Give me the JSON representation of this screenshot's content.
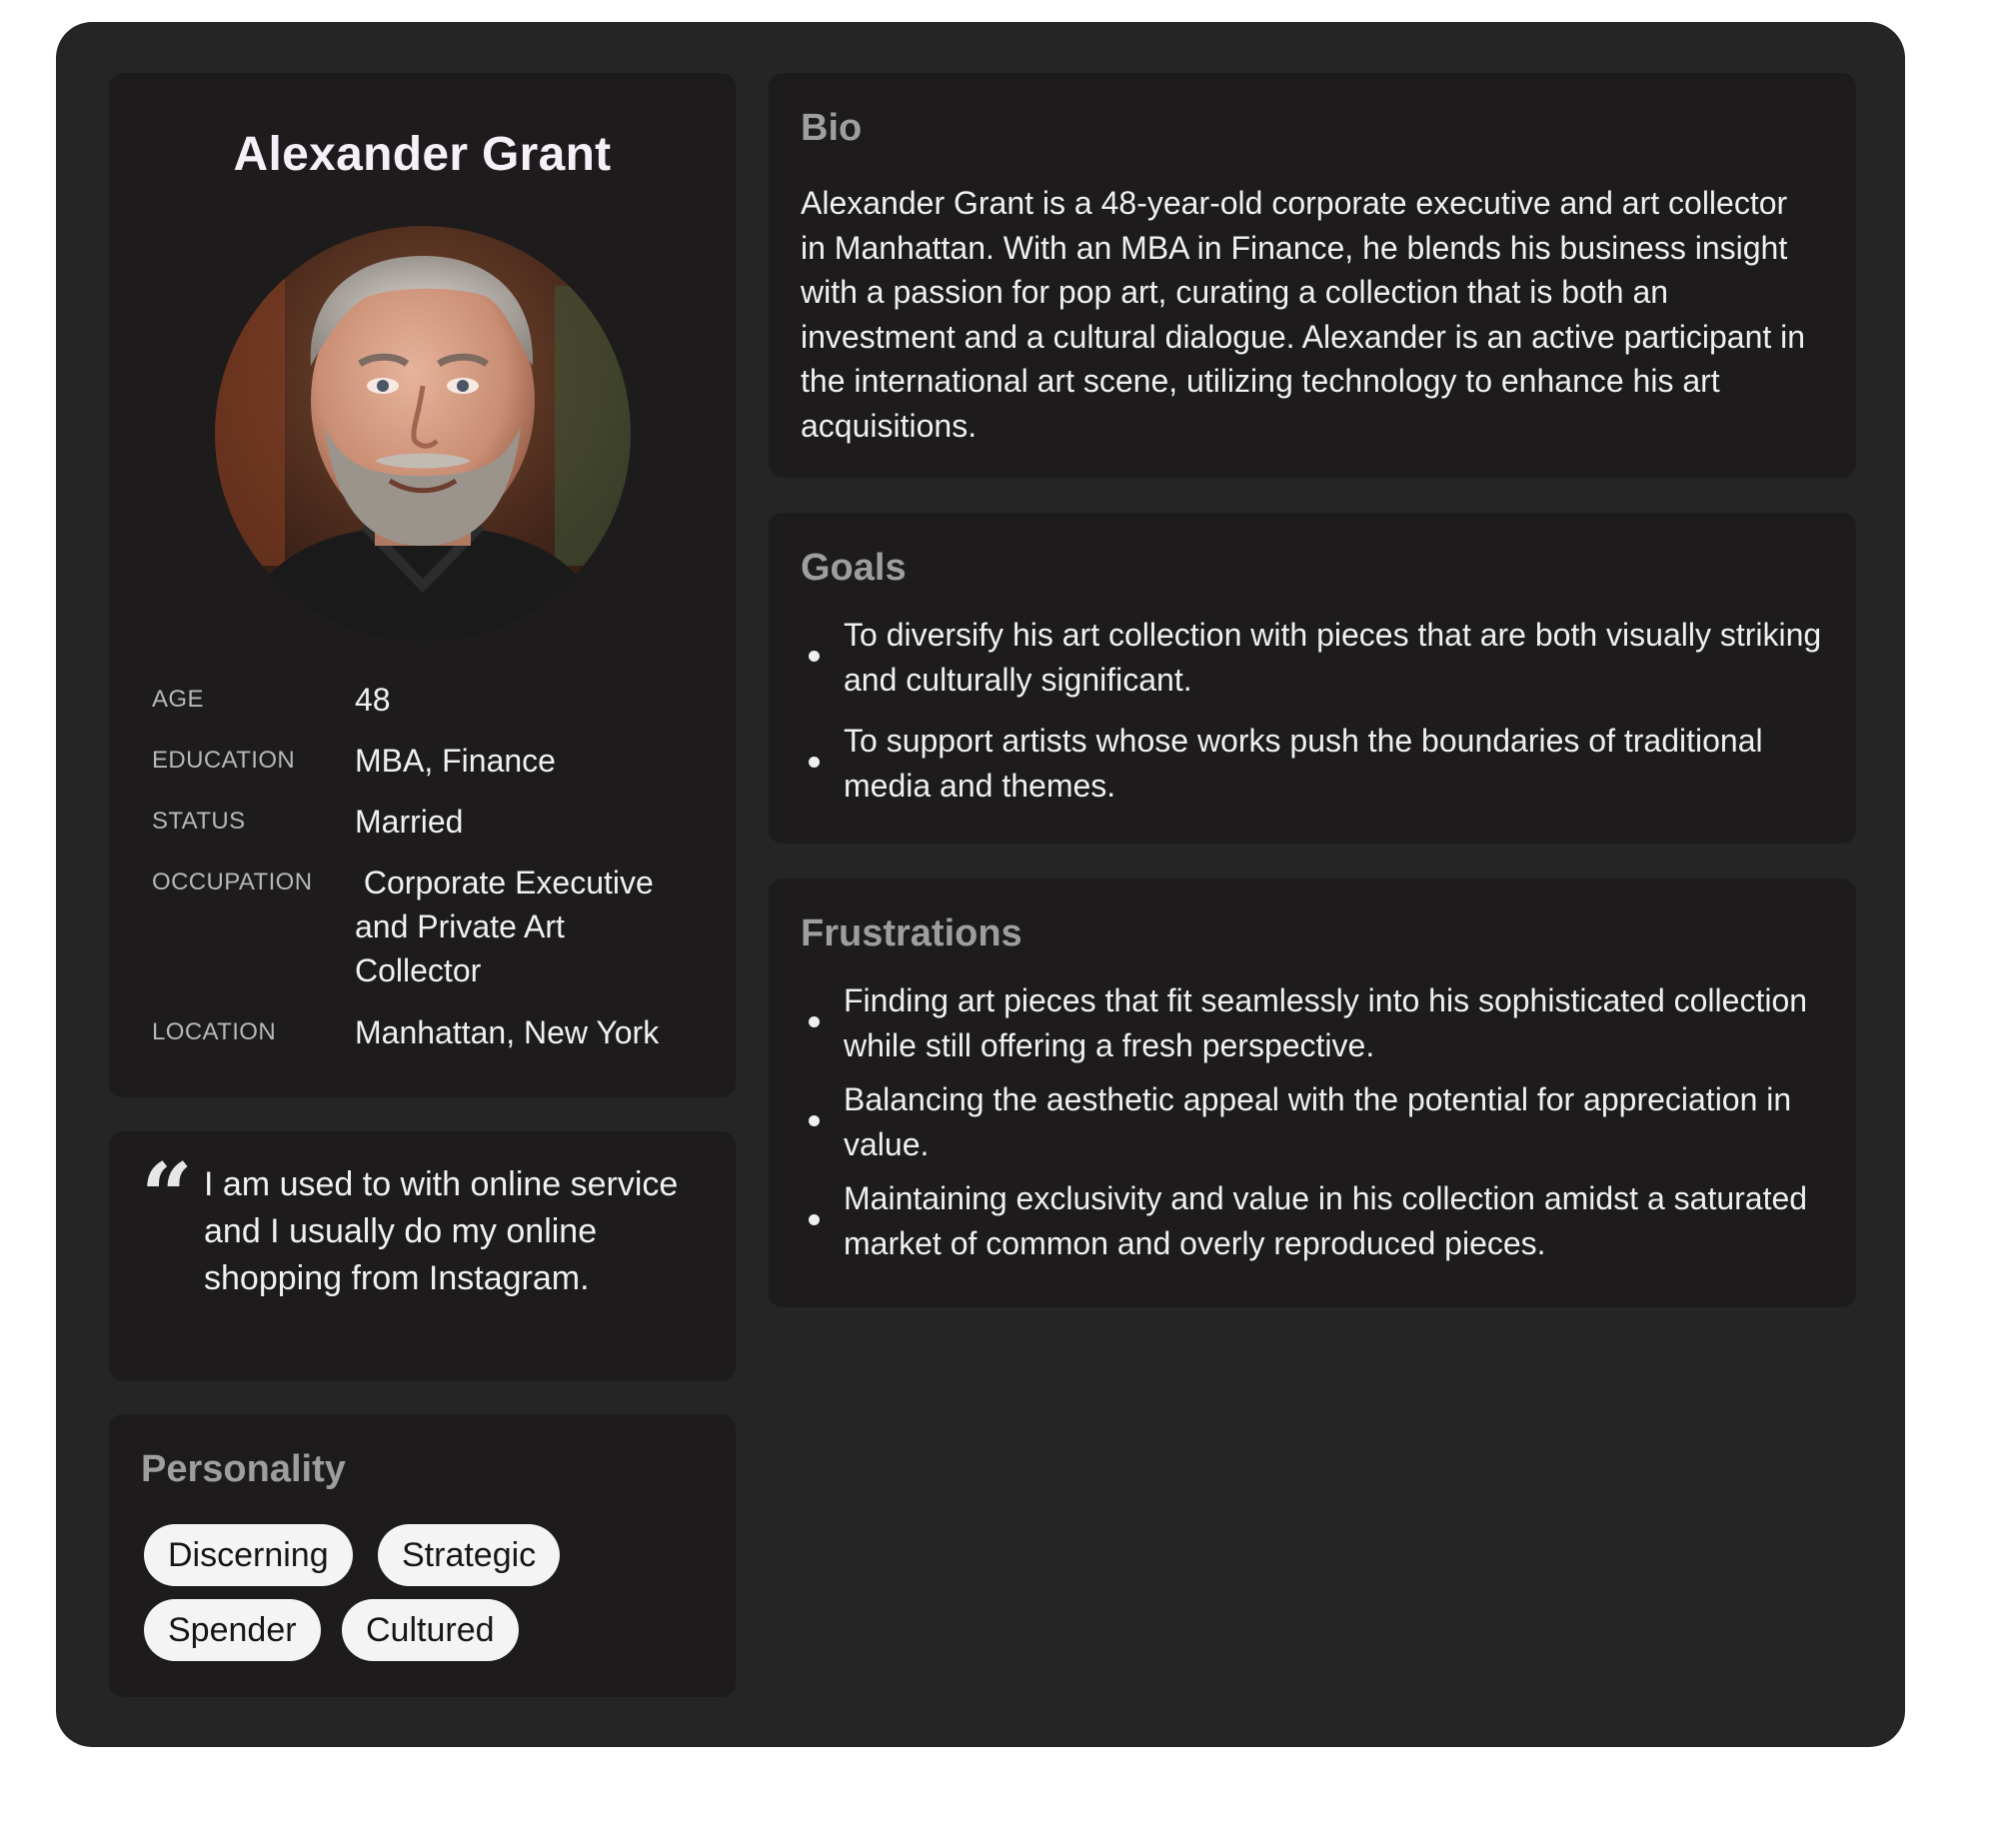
{
  "persona": {
    "name": "Alexander Grant",
    "facts": [
      {
        "label": "AGE",
        "value": "48"
      },
      {
        "label": "EDUCATION",
        "value": "MBA, Finance"
      },
      {
        "label": "STATUS",
        "value": "Married"
      },
      {
        "label": "OCCUPATION",
        "value": " Corporate Executive and Private Art Collector"
      },
      {
        "label": "LOCATION",
        "value": "Manhattan, New York"
      }
    ],
    "quote": "I am used to with online service and I usually do my online shopping from Instagram.",
    "quote_icon": "quote-icon",
    "personality": {
      "title": "Personality",
      "tags": [
        "Discerning",
        "Strategic",
        "Spender",
        "Cultured"
      ]
    }
  },
  "bio": {
    "title": "Bio",
    "text": "Alexander Grant is a 48-year-old corporate executive and art collector in Manhattan. With an MBA in Finance, he blends his business insight with a passion for pop art, curating a collection that is both an investment and a cultural dialogue. Alexander is an active participant in the international art scene, utilizing technology to enhance his art acquisitions."
  },
  "goals": {
    "title": "Goals",
    "items": [
      "To diversify his art collection with pieces that are both visually striking and culturally significant.",
      "To support artists whose works push the boundaries of traditional media and themes."
    ]
  },
  "frustrations": {
    "title": "Frustrations",
    "items": [
      "Finding art pieces that fit seamlessly into his sophisticated collection while still offering a fresh perspective.",
      "Balancing the aesthetic appeal with the potential for appreciation in value.",
      "Maintaining exclusivity and value in his collection amidst a saturated market of common and overly reproduced pieces."
    ]
  },
  "colors": {
    "card_bg": "#252526",
    "panel_bg": "#1d1b1c",
    "heading_gray": "#9e9e9e",
    "tag_bg": "#f4f4f4",
    "tag_text": "#161616"
  }
}
